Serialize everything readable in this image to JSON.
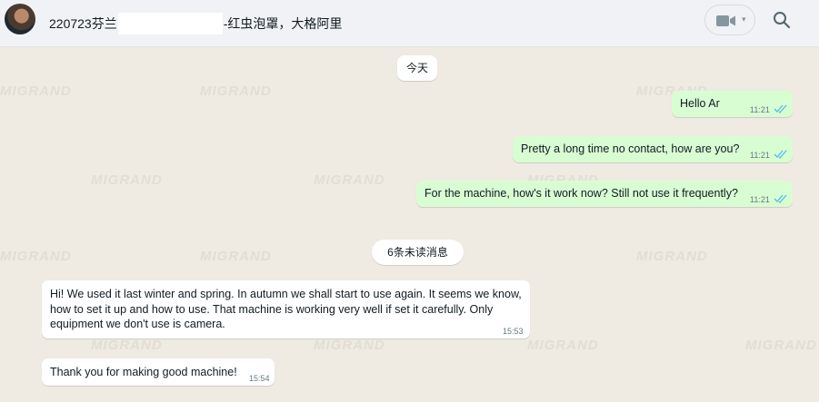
{
  "header": {
    "title_prefix": "220723芬兰",
    "title_suffix": "-红虫泡罩，大格阿里",
    "video_icon": "video-camera-icon",
    "search_icon": "search-icon"
  },
  "watermark": "MIGRAND",
  "date_divider": "今天",
  "unread_divider": "6条未读消息",
  "messages_out": [
    {
      "text": "Hello Ar",
      "time": "11:21"
    },
    {
      "text": "Pretty a long time no contact, how are you?",
      "time": "11:21"
    },
    {
      "text": "For the machine, how's it work now? Still not use it frequently?",
      "time": "11:21"
    }
  ],
  "messages_in": [
    {
      "text": "Hi! We used it last winter and spring. In autumn we shall start to use again. It seems we know, how to set it up and how to use. That machine is working very well if set it carefully. Only equipment we don't use is camera.",
      "time": "15:53"
    },
    {
      "text": "Thank you for making good machine!",
      "time": "15:54"
    }
  ],
  "colors": {
    "outgoing": "#d9fdd3",
    "incoming": "#ffffff",
    "tick": "#53bdeb",
    "background": "#efeae2"
  }
}
